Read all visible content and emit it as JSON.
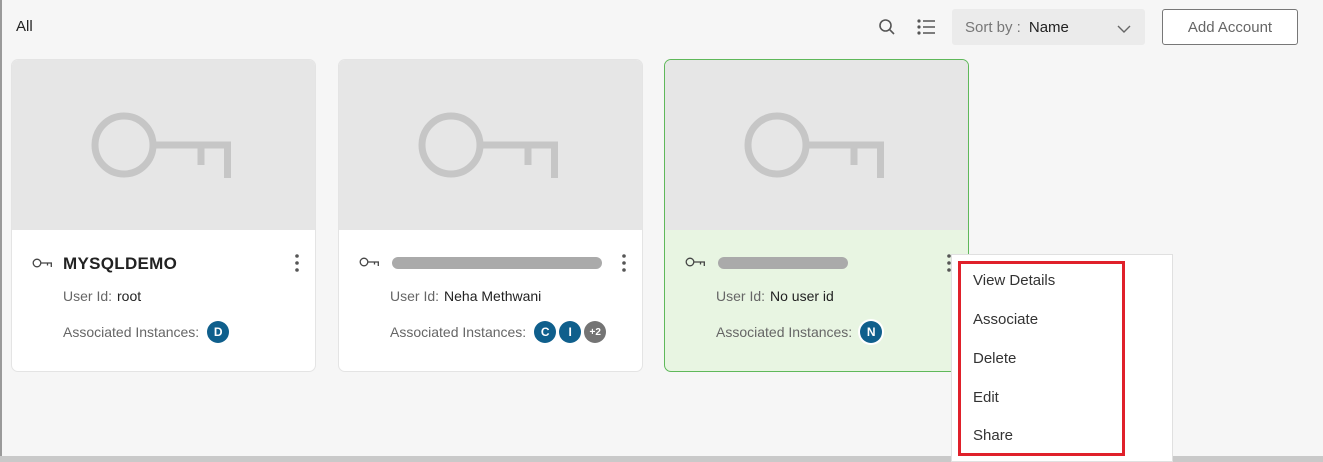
{
  "toolbar": {
    "title": "All",
    "search_icon": "search-icon",
    "list_view_icon": "list-view-icon",
    "sort_label": "Sort by :",
    "sort_value": "Name",
    "add_account_label": "Add Account"
  },
  "cards": [
    {
      "name": "MYSQLDEMO",
      "user_id_label": "User Id:",
      "user_id": "root",
      "instances_label": "Associated Instances:",
      "instances": [
        "D"
      ],
      "selected": false
    },
    {
      "name": "",
      "name_redacted": true,
      "user_id_label": "User Id:",
      "user_id": "Neha Methwani",
      "instances_label": "Associated Instances:",
      "instances": [
        "C",
        "I"
      ],
      "instances_more": "+2",
      "selected": false
    },
    {
      "name": "",
      "name_redacted": true,
      "user_id_label": "User Id:",
      "user_id": "No user id",
      "instances_label": "Associated Instances:",
      "instances": [
        "N"
      ],
      "selected": true
    }
  ],
  "context_menu": {
    "items": [
      "View Details",
      "Associate",
      "Delete",
      "Edit",
      "Share"
    ]
  },
  "colors": {
    "accent_avatar": "#0f5f8c",
    "selected_card_bg": "#e8f5e2",
    "selected_card_border": "#5fb85a",
    "highlight_border": "#e0202a"
  }
}
